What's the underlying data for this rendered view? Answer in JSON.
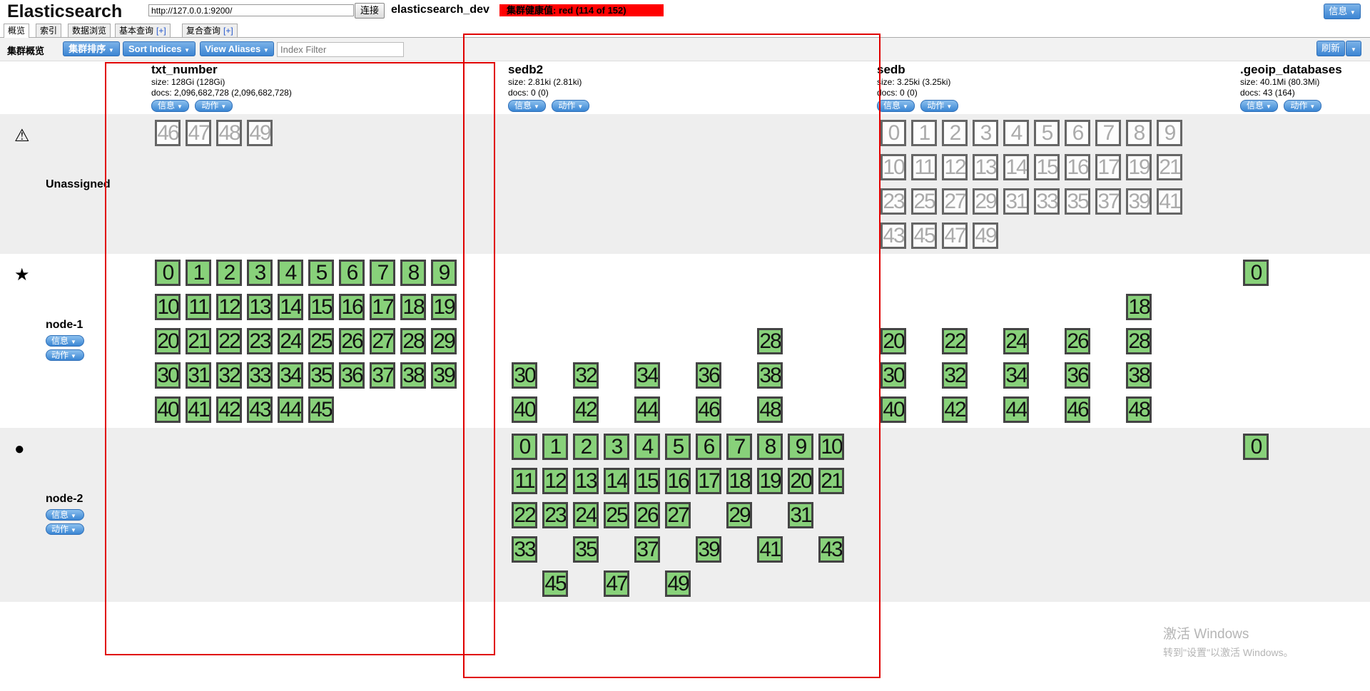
{
  "header": {
    "app_title": "Elasticsearch",
    "url": "http://127.0.0.1:9200/",
    "connect_label": "连接",
    "cluster_name": "elasticsearch_dev",
    "health": "集群健康值: red (114 of 152)",
    "info_label": "信息"
  },
  "tabs": [
    {
      "label": "概览"
    },
    {
      "label": "索引"
    },
    {
      "label": "数据浏览"
    },
    {
      "label": "基本查询",
      "plus": "[+]"
    },
    {
      "label": "复合查询",
      "plus": "[+]"
    }
  ],
  "toolbar": {
    "label": "集群概览",
    "sort_cluster": "集群排序",
    "sort_indices": "Sort Indices",
    "view_aliases": "View Aliases",
    "index_filter_placeholder": "Index Filter",
    "refresh": "刷新"
  },
  "pills": {
    "info": "信息",
    "action": "动作"
  },
  "indices": [
    {
      "name": "txt_number",
      "size": "size: 128Gi (128Gi)",
      "docs": "docs: 2,096,682,728 (2,096,682,728)"
    },
    {
      "name": "sedb2",
      "size": "size: 2.81ki (2.81ki)",
      "docs": "docs: 0 (0)"
    },
    {
      "name": "sedb",
      "size": "size: 3.25ki (3.25ki)",
      "docs": "docs: 0 (0)"
    },
    {
      "name": ".geoip_databases",
      "size": "size: 40.1Mi (80.3Mi)",
      "docs": "docs: 43 (164)"
    }
  ],
  "rows": [
    {
      "icon": "⚠",
      "label": "Unassigned"
    },
    {
      "icon": "★",
      "label": "node-1"
    },
    {
      "icon": "●",
      "label": "node-2"
    }
  ],
  "shards": {
    "unassigned": {
      "txt_number": [
        "46",
        "47",
        "48",
        "49"
      ],
      "sedb": [
        "0",
        "1",
        "2",
        "3",
        "4",
        "5",
        "6",
        "7",
        "8",
        "9",
        "10",
        "11",
        "12",
        "13",
        "14",
        "15",
        "16",
        "17",
        "19",
        "21",
        "23",
        "25",
        "27",
        "29",
        "31",
        "33",
        "35",
        "37",
        "39",
        "41",
        "43",
        "45",
        "47",
        "49"
      ]
    },
    "node1": {
      "txt_number": [
        "0",
        "1",
        "2",
        "3",
        "4",
        "5",
        "6",
        "7",
        "8",
        "9",
        "10",
        "11",
        "12",
        "13",
        "14",
        "15",
        "16",
        "17",
        "18",
        "19",
        "20",
        "21",
        "22",
        "23",
        "24",
        "25",
        "26",
        "27",
        "28",
        "29",
        "30",
        "31",
        "32",
        "33",
        "34",
        "35",
        "36",
        "37",
        "38",
        "39",
        "40",
        "41",
        "42",
        "43",
        "44",
        "45"
      ],
      "sedb2": [
        "28",
        "30",
        "32",
        "34",
        "36",
        "38",
        "40",
        "42",
        "44",
        "46",
        "48"
      ],
      "sedb": [
        "18",
        "20",
        "22",
        "24",
        "26",
        "28",
        "30",
        "32",
        "34",
        "36",
        "38",
        "40",
        "42",
        "44",
        "46",
        "48"
      ],
      "geoip": [
        "0"
      ]
    },
    "node2": {
      "sedb2": [
        "0",
        "1",
        "2",
        "3",
        "4",
        "5",
        "6",
        "7",
        "8",
        "9",
        "10",
        "11",
        "12",
        "13",
        "14",
        "15",
        "16",
        "17",
        "18",
        "19",
        "20",
        "21",
        "22",
        "23",
        "24",
        "25",
        "26",
        "27",
        "29",
        "31",
        "33",
        "35",
        "37",
        "39",
        "41",
        "43",
        "45",
        "47",
        "49"
      ],
      "geoip": [
        "0"
      ]
    }
  },
  "watermark": {
    "line1": "激活 Windows",
    "line2": "转到\"设置\"以激活 Windows。"
  }
}
